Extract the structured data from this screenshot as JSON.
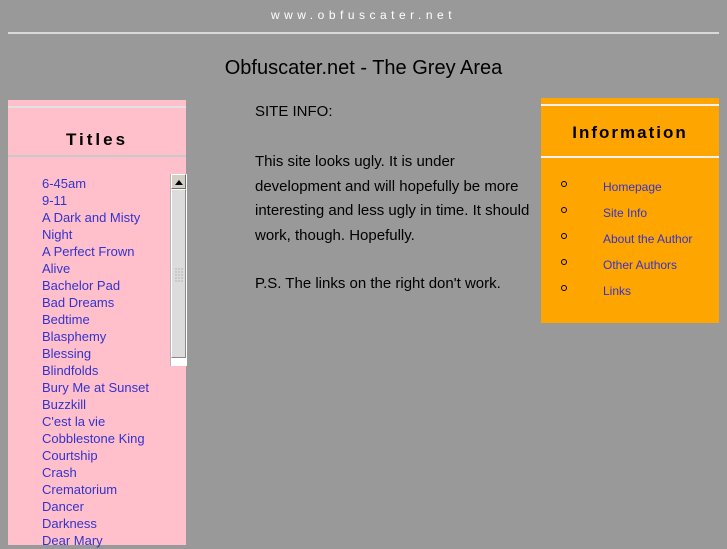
{
  "banner": {
    "site_url": "www.obfuscater.net"
  },
  "page": {
    "title": "Obfuscater.net - The Grey Area"
  },
  "titles_panel": {
    "heading": "Titles",
    "items": [
      "6-45am",
      "9-11",
      "A Dark and Misty Night",
      "A Perfect Frown",
      "Alive",
      "Bachelor Pad",
      "Bad Dreams",
      "Bedtime",
      "Blasphemy",
      "Blessing",
      "Blindfolds",
      "Bury Me at Sunset",
      "Buzzkill",
      "C'est la vie",
      "Cobblestone King",
      "Courtship",
      "Crash",
      "Crematorium",
      "Dancer",
      "Darkness",
      "Dear Mary"
    ],
    "scrollbar": {
      "up_arrow_icon": "triangle-up-icon",
      "thumb_grip_icon": "grip-dots-icon"
    }
  },
  "main": {
    "section_label": "SITE INFO:",
    "body": "This site looks ugly. It is under development and will hopefully be more interesting and less ugly in time. It should work, though. Hopefully.",
    "postscript": "P.S. The links on the right don't work."
  },
  "info_panel": {
    "heading": "Information",
    "links": [
      "Homepage",
      "Site Info",
      "About the Author",
      "Other Authors",
      "Links"
    ],
    "bullet_icon": "circle-outline-icon"
  },
  "colors": {
    "page_background": "#999999",
    "titles_panel_background": "#ffc0cb",
    "info_panel_background": "#ffa500",
    "link_color": "#3333cc",
    "banner_text_color": "#ffffff",
    "text_color": "#000000"
  }
}
